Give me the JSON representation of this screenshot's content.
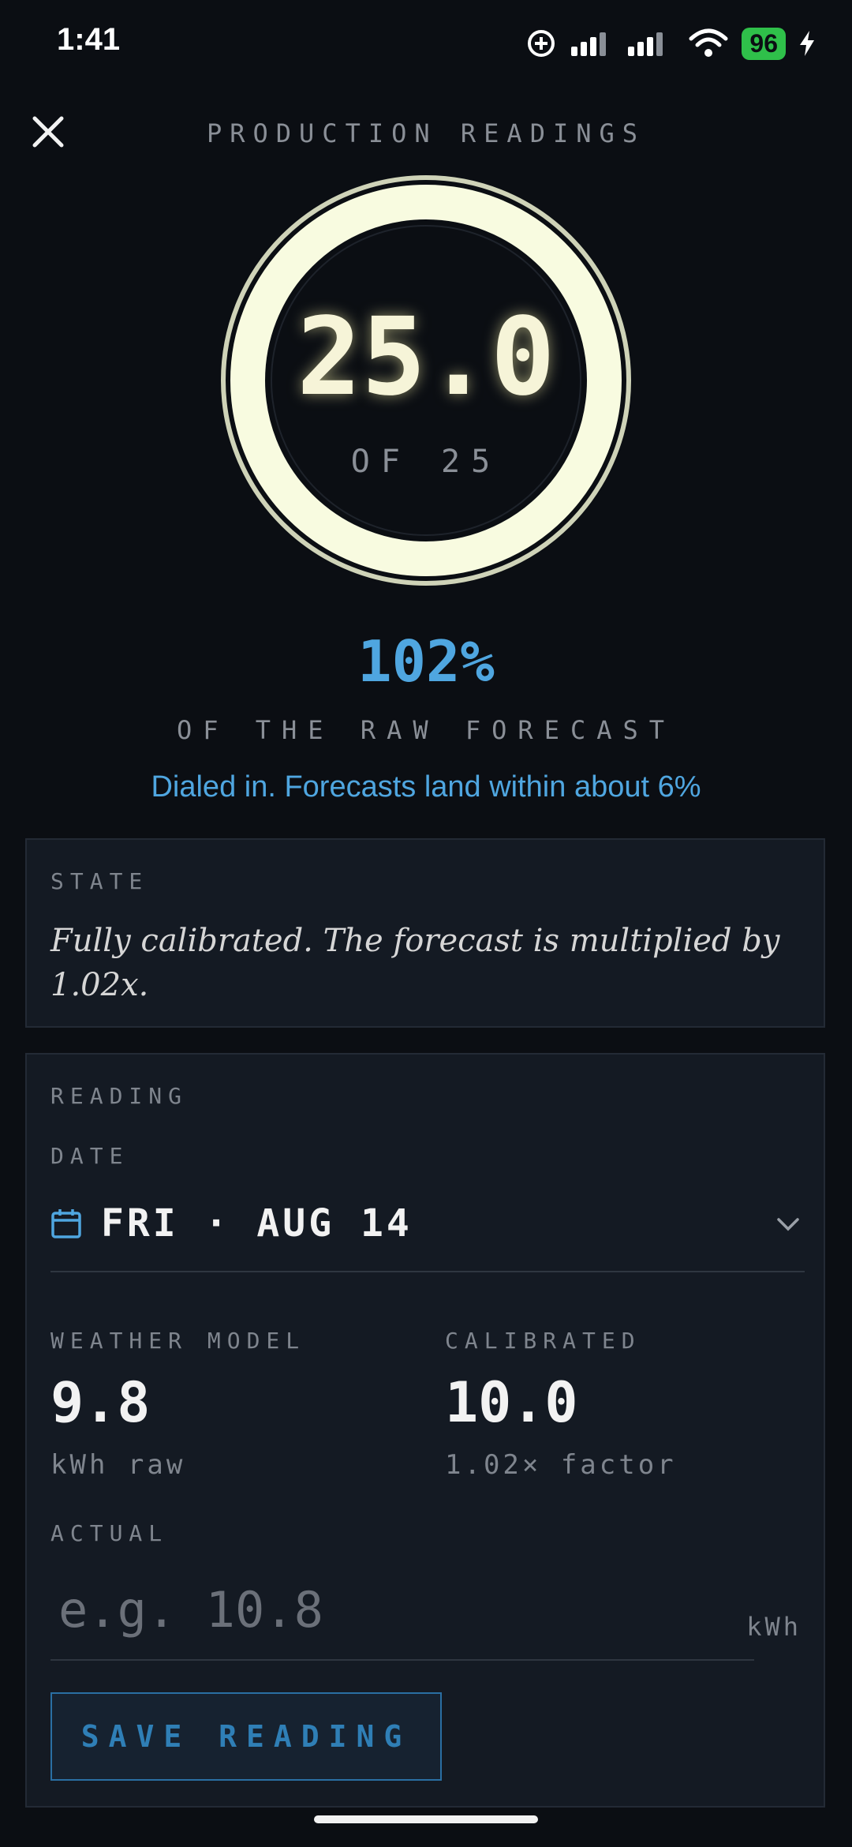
{
  "status_bar": {
    "time": "1:41",
    "battery": "96"
  },
  "header": {
    "title": "PRODUCTION READINGS"
  },
  "ring": {
    "value": "25.0",
    "of_label": "OF 25",
    "progress": 1.0
  },
  "summary": {
    "percent": "102%",
    "caption": "OF THE RAW FORECAST",
    "note": "Dialed in. Forecasts land within about 6%"
  },
  "state": {
    "label": "STATE",
    "text": "Fully calibrated. The forecast is multiplied by 1.02x."
  },
  "reading": {
    "label": "READING",
    "date_label": "DATE",
    "date_value": "FRI · AUG 14",
    "weather_label": "WEATHER MODEL",
    "weather_value": "9.8",
    "weather_sub": "kWh raw",
    "calibrated_label": "CALIBRATED",
    "calibrated_value": "10.0",
    "calibrated_sub": "1.02× factor",
    "actual_label": "ACTUAL",
    "actual_placeholder": "e.g. 10.8",
    "actual_value": "",
    "unit": "kWh",
    "save_label": "SAVE READING"
  },
  "colors": {
    "accent": "#4fa6e0",
    "ring": "#f8fbe0",
    "background": "#0b0e13"
  },
  "icons": {
    "close": "close-icon",
    "calendar": "calendar-icon",
    "chevron": "chevron-down-icon"
  }
}
